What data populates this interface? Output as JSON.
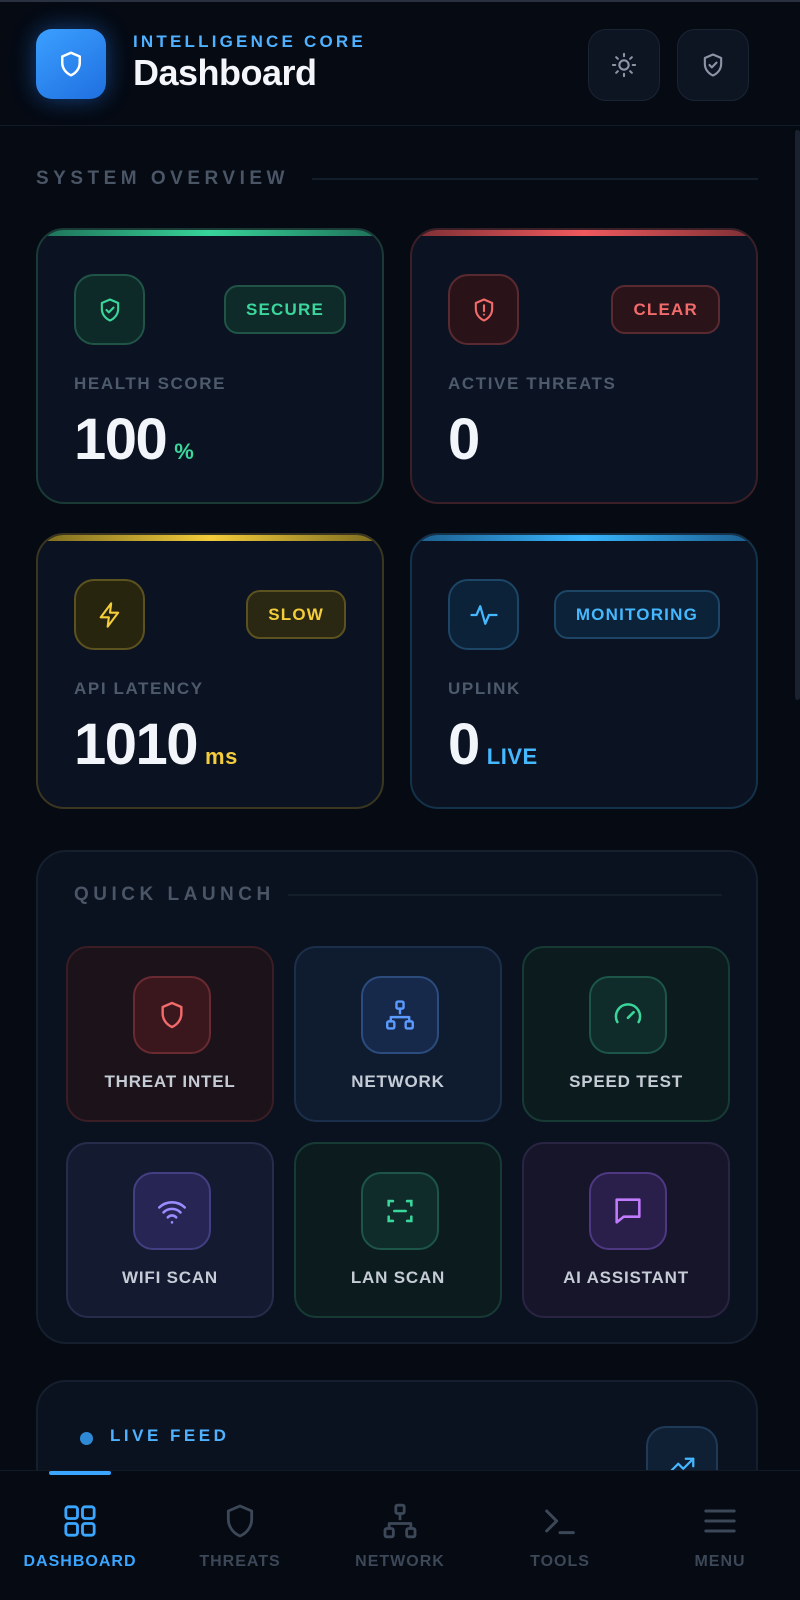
{
  "header": {
    "subtitle": "INTELLIGENCE CORE",
    "title": "Dashboard"
  },
  "overview": {
    "title": "SYSTEM OVERVIEW",
    "cards": [
      {
        "label": "HEALTH SCORE",
        "value": "100",
        "unit": "%",
        "badge": "SECURE",
        "icon": "shield-check-icon",
        "color": "#3ad69b"
      },
      {
        "label": "ACTIVE THREATS",
        "value": "0",
        "unit": "",
        "badge": "CLEAR",
        "icon": "shield-alert-icon",
        "color": "#f26b6b"
      },
      {
        "label": "API LATENCY",
        "value": "1010",
        "unit": "ms",
        "badge": "SLOW",
        "icon": "lightning-icon",
        "color": "#f4cd3c"
      },
      {
        "label": "UPLINK",
        "value": "0",
        "unit": "LIVE",
        "badge": "MONITORING",
        "icon": "pulse-icon",
        "color": "#45b8ff"
      }
    ]
  },
  "quick_launch": {
    "title": "QUICK LAUNCH",
    "tiles": [
      {
        "label": "THREAT INTEL",
        "icon": "shield-icon"
      },
      {
        "label": "NETWORK",
        "icon": "network-icon"
      },
      {
        "label": "SPEED TEST",
        "icon": "speedometer-icon"
      },
      {
        "label": "WIFI SCAN",
        "icon": "wifi-icon"
      },
      {
        "label": "LAN SCAN",
        "icon": "scan-icon"
      },
      {
        "label": "AI ASSISTANT",
        "icon": "chat-icon"
      }
    ]
  },
  "live_feed": {
    "title": "LIVE FEED"
  },
  "nav": {
    "items": [
      {
        "label": "DASHBOARD",
        "icon": "grid-icon",
        "active": true
      },
      {
        "label": "THREATS",
        "icon": "shield-icon",
        "active": false
      },
      {
        "label": "NETWORK",
        "icon": "network-icon",
        "active": false
      },
      {
        "label": "TOOLS",
        "icon": "terminal-icon",
        "active": false
      },
      {
        "label": "MENU",
        "icon": "hamburger-icon",
        "active": false
      }
    ]
  },
  "colors": {
    "accent": "#3aa6ff",
    "background": "#050a13",
    "green": "#3ad69b",
    "red": "#f26b6b",
    "yellow": "#f4cd3c",
    "blue": "#45b8ff",
    "purple": "#9b8cff",
    "violet": "#c17bff"
  }
}
